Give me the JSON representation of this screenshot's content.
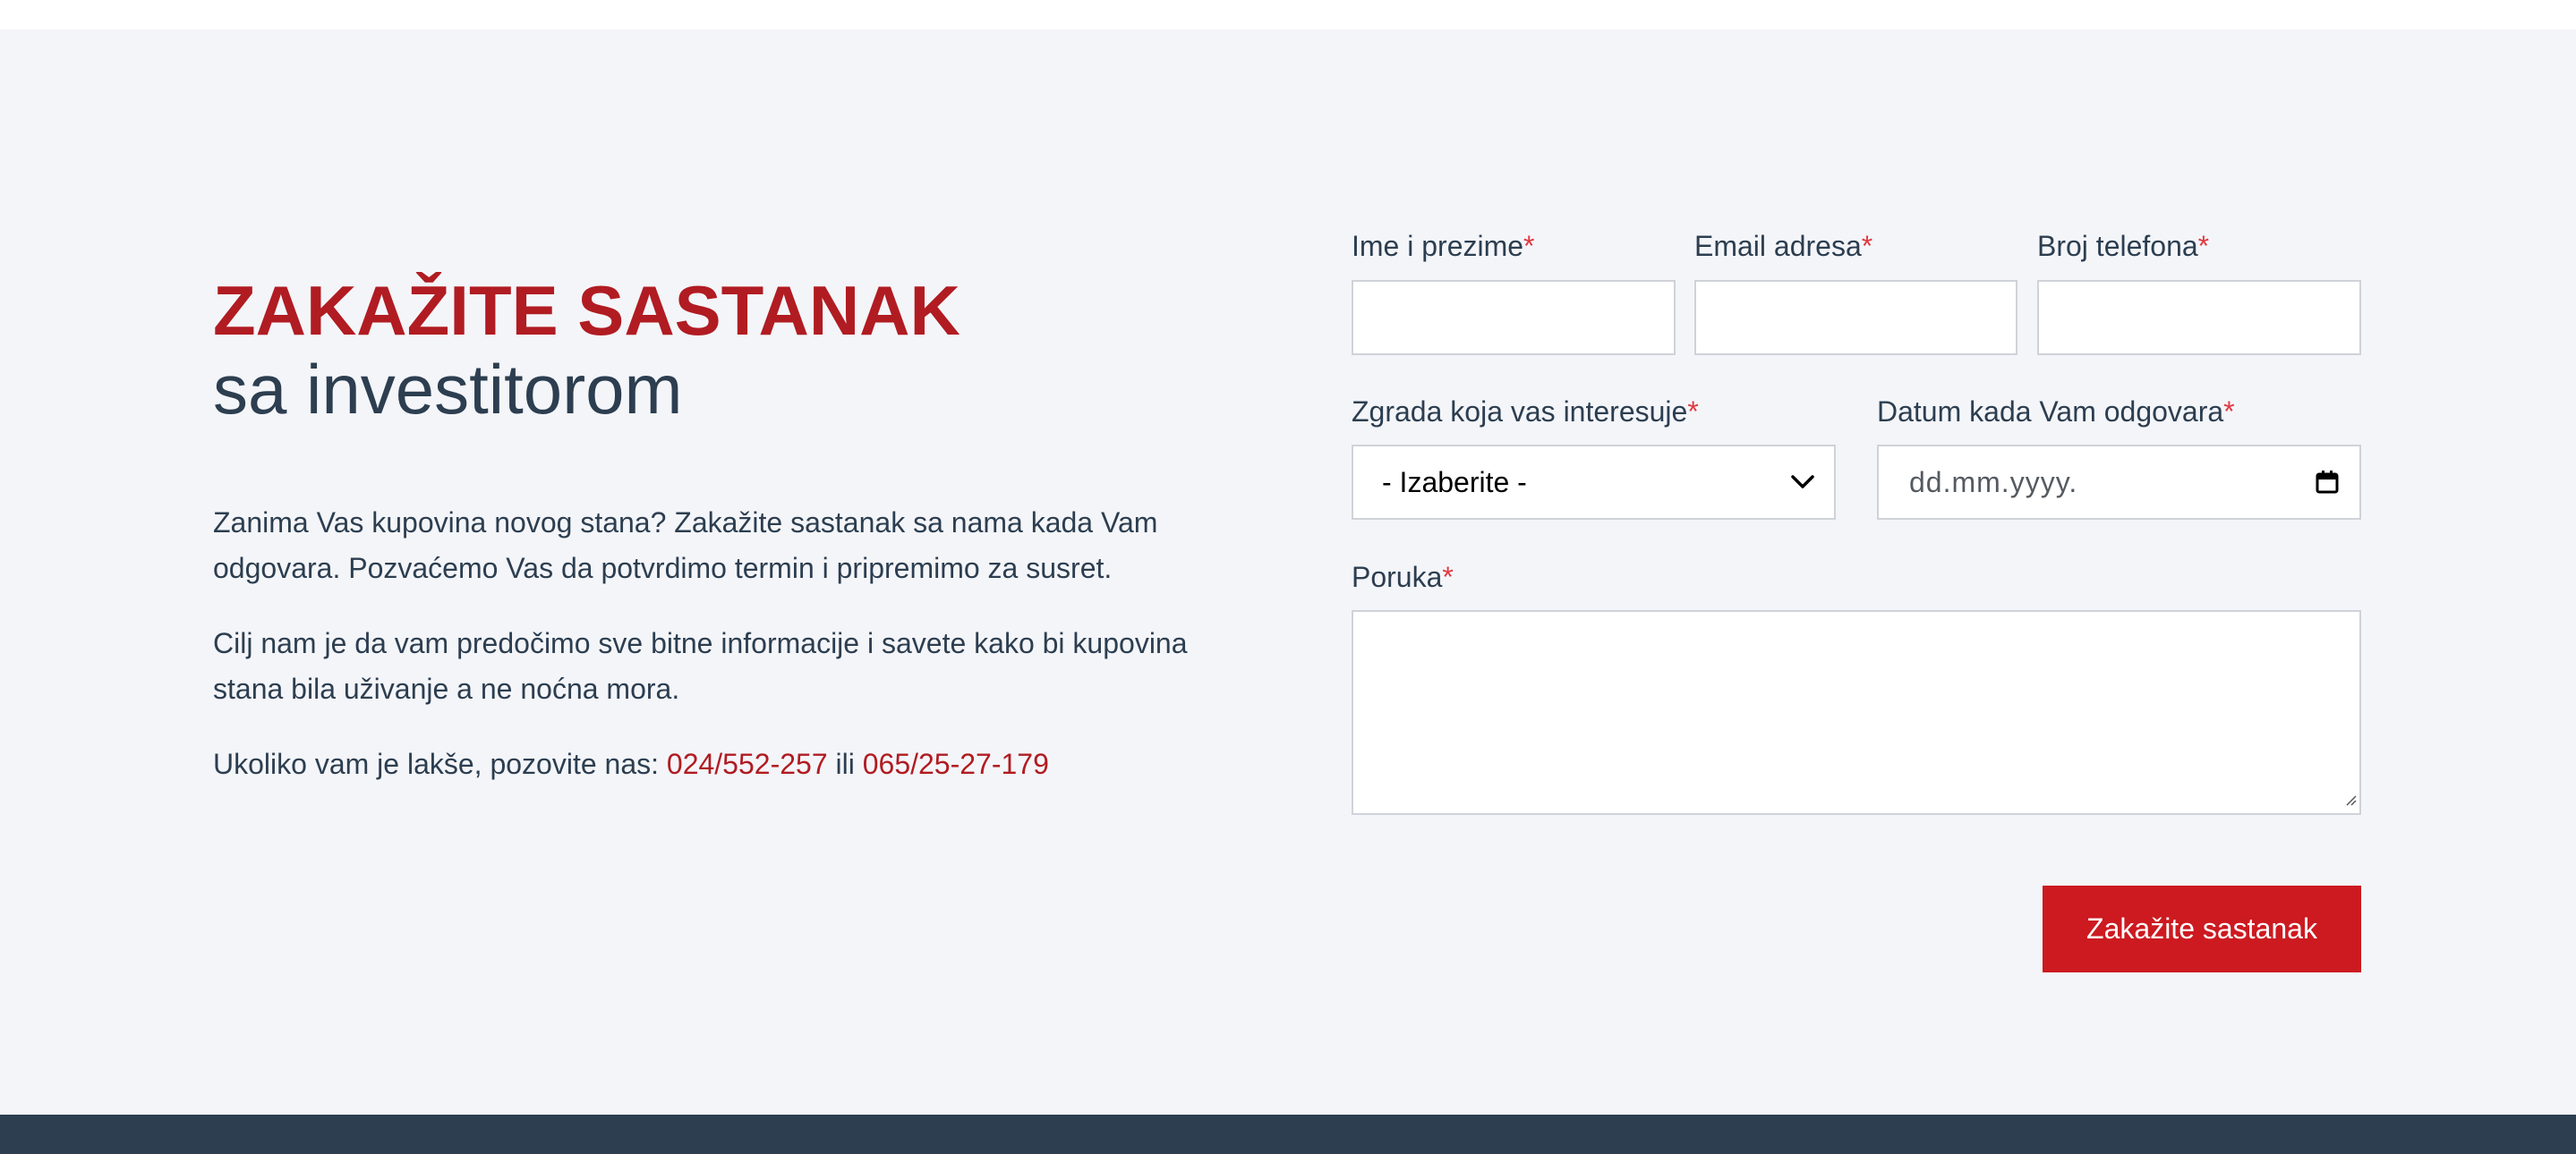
{
  "heading": {
    "main": "ZAKAŽITE SASTANAK",
    "sub": "sa investitorom"
  },
  "intro": {
    "p1": "Zanima Vas kupovina novog stana? Zakažite sastanak sa nama kada Vam odgovara. Pozvaćemo Vas da potvrdimo termin i pripremimo za susret.",
    "p2": "Cilj nam je da vam predočimo sve bitne informacije i savete kako bi kupovina stana bila uživanje a ne noćna mora.",
    "p3_prefix": "Ukoliko vam je lakše, pozovite nas: ",
    "phone1": "024/552-257",
    "p3_or": " ili ",
    "phone2": "065/25-27-179"
  },
  "form": {
    "required_mark": "*",
    "name_label": "Ime i prezime",
    "name_value": "",
    "email_label": "Email adresa",
    "email_value": "",
    "phone_label": "Broj telefona",
    "phone_value": "",
    "building_label": "Zgrada koja vas interesuje",
    "building_selected": "- Izaberite -",
    "date_label": "Datum kada Vam odgovara",
    "date_placeholder": "dd.mm.yyyy.",
    "message_label": "Poruka",
    "message_value": "",
    "submit_label": "Zakažite sastanak"
  },
  "icons": {
    "select": "chevron-down-icon",
    "date": "calendar-icon",
    "textarea": "resize-handle-icon"
  },
  "colors": {
    "accent_red": "#b01c22",
    "button_red": "#cc1a20",
    "text_dark": "#2c3e50",
    "section_bg": "#f4f5f9",
    "footer_bg": "#2c3e50"
  }
}
